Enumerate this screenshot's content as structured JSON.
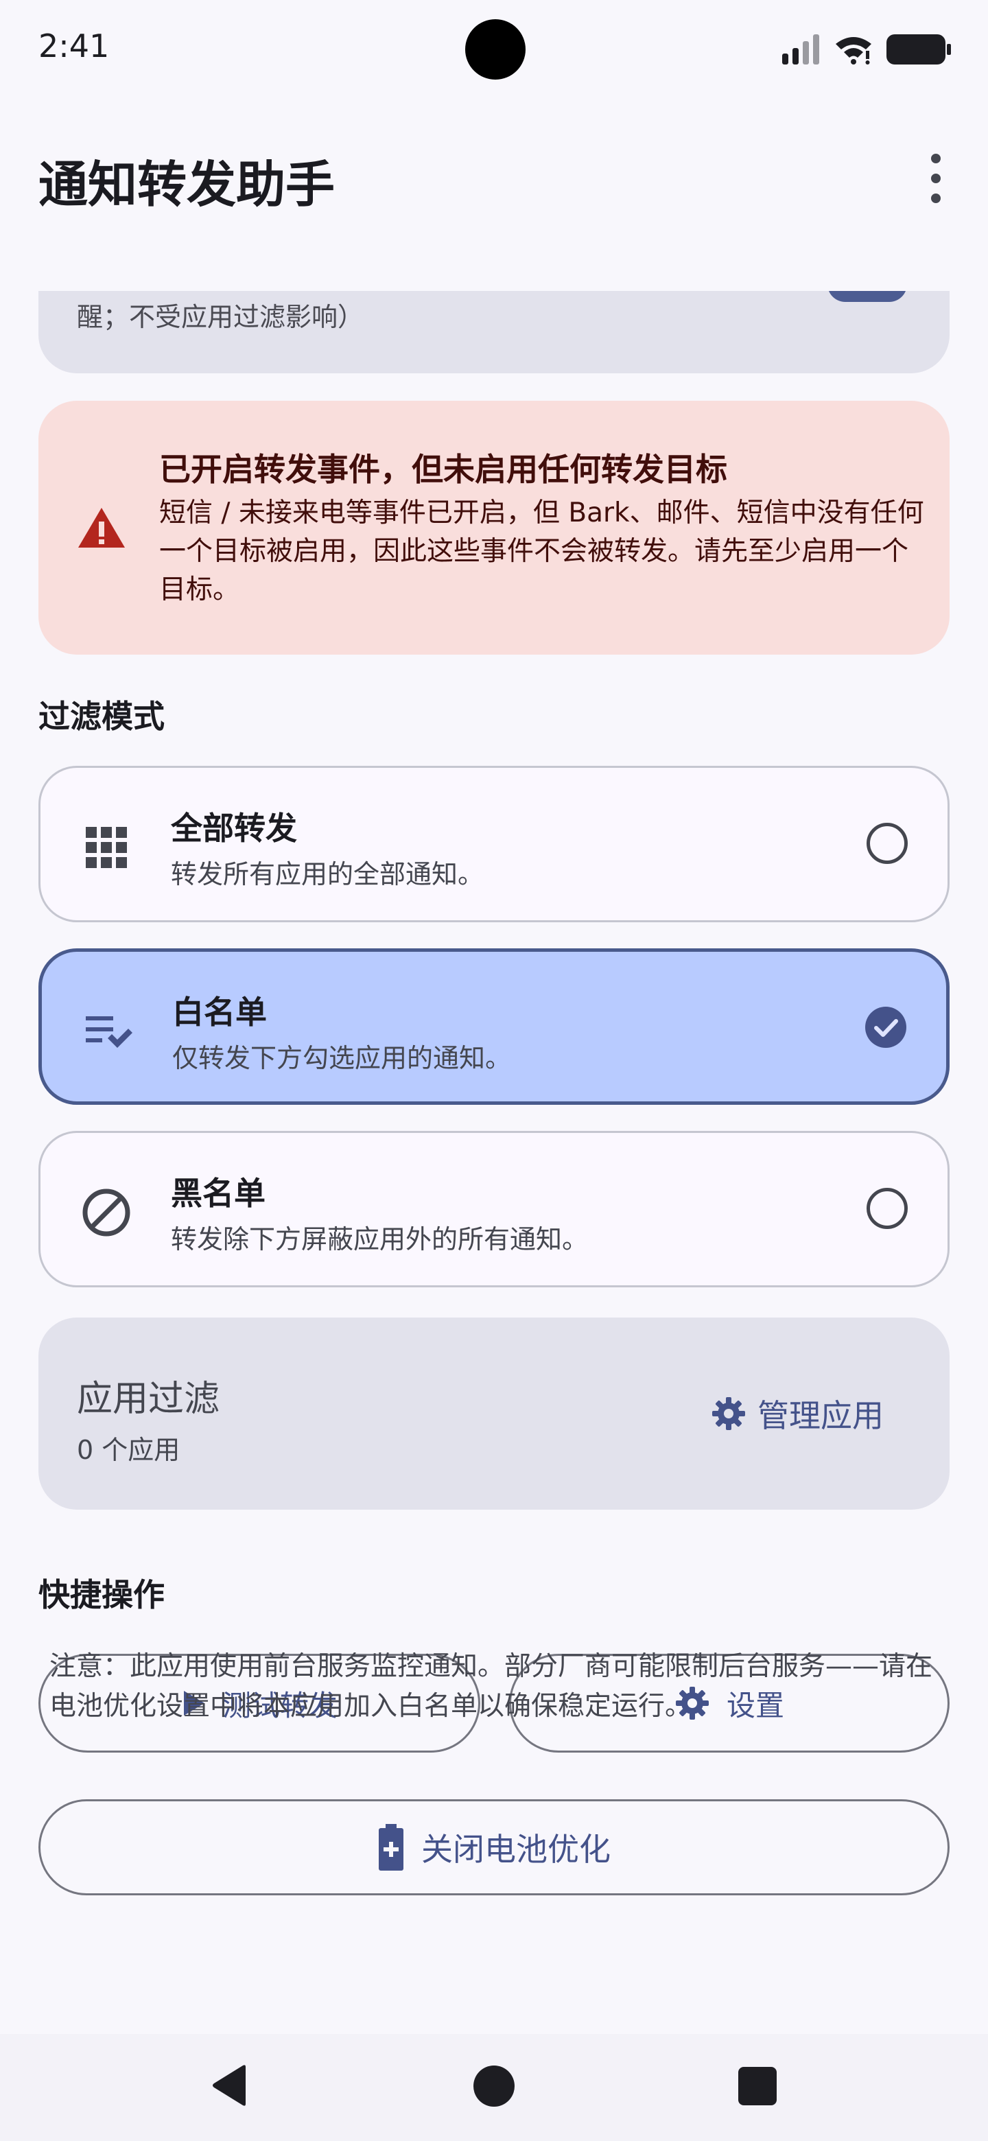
{
  "status_bar": {
    "time": "2:41"
  },
  "app_bar": {
    "title": "通知转发助手"
  },
  "partial_card": {
    "text": "醒；不受应用过滤影响）"
  },
  "warning": {
    "title": "已开启转发事件，但未启用任何转发目标",
    "body": "短信 / 未接来电等事件已开启，但 Bark、邮件、短信中没有任何一个目标被启用，因此这些事件不会被转发。请先至少启用一个目标。"
  },
  "filter_mode": {
    "label": "过滤模式",
    "options": [
      {
        "title": "全部转发",
        "subtitle": "转发所有应用的全部通知。",
        "icon": "apps-grid-icon",
        "selected": false
      },
      {
        "title": "白名单",
        "subtitle": "仅转发下方勾选应用的通知。",
        "icon": "playlist-check-icon",
        "selected": true
      },
      {
        "title": "黑名单",
        "subtitle": "转发除下方屏蔽应用外的所有通知。",
        "icon": "block-icon",
        "selected": false
      }
    ]
  },
  "app_filter": {
    "title": "应用过滤",
    "count": "0 个应用",
    "manage_label": "管理应用"
  },
  "quick_actions": {
    "label": "快捷操作",
    "test_label": "测试转发",
    "settings_label": "设置",
    "battery_label": "关闭电池优化"
  },
  "note": "注意：此应用使用前台服务监控通知。部分厂商可能限制后台服务——请在电池优化设置中将本应用加入白名单以确保稳定运行。",
  "colors": {
    "primary": "#44528a",
    "selected_bg": "#b8cbff",
    "warning_bg": "#f9dedc",
    "warning_icon": "#b3261e"
  }
}
